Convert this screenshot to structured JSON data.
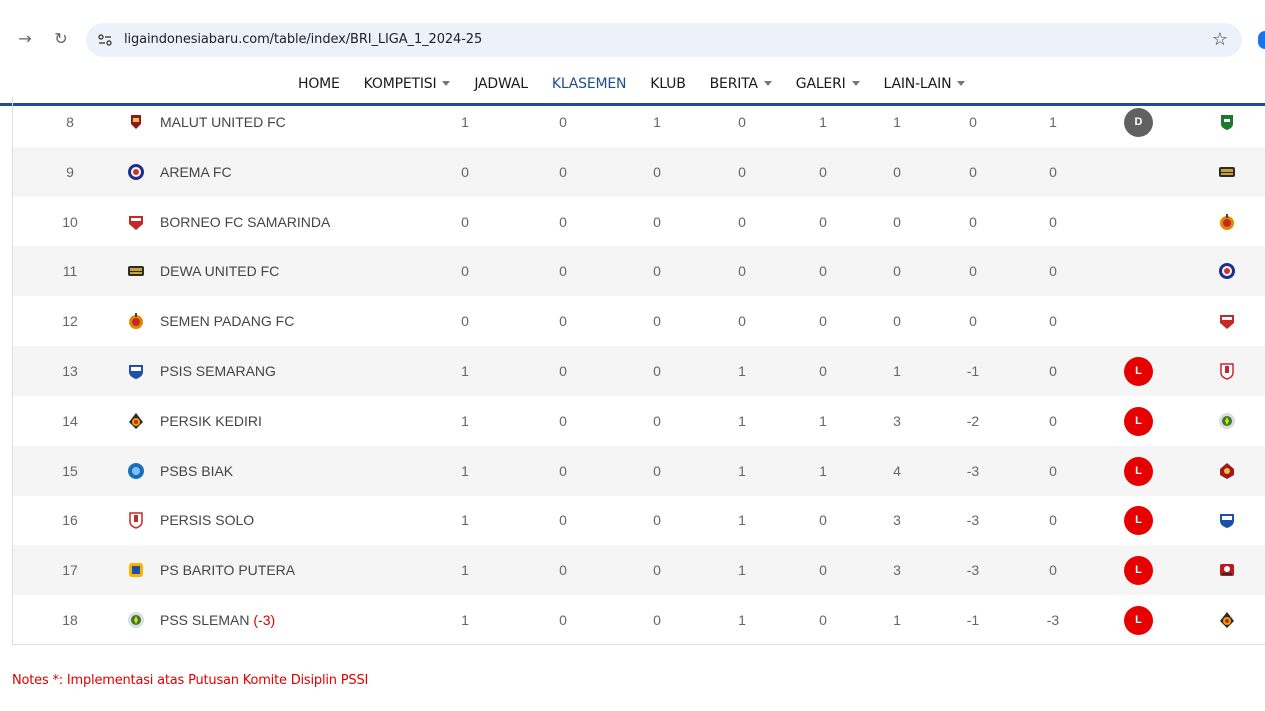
{
  "browser": {
    "back_icon": "arrow-right",
    "reload_icon": "reload",
    "url": "ligaindonesiabaru.com/table/index/BRI_LIGA_1_2024-25",
    "bookmark_icon": "star"
  },
  "menu": [
    {
      "label": "HOME",
      "dropdown": false,
      "active": false
    },
    {
      "label": "KOMPETISI",
      "dropdown": true,
      "active": false
    },
    {
      "label": "JADWAL",
      "dropdown": false,
      "active": false
    },
    {
      "label": "KLASEMEN",
      "dropdown": false,
      "active": true
    },
    {
      "label": "KLUB",
      "dropdown": false,
      "active": false
    },
    {
      "label": "BERITA",
      "dropdown": true,
      "active": false
    },
    {
      "label": "GALERI",
      "dropdown": true,
      "active": false
    },
    {
      "label": "LAIN-LAIN",
      "dropdown": true,
      "active": false
    }
  ],
  "standings": [
    {
      "pos": "8",
      "team": "MALUT UNITED FC",
      "deduction": "",
      "vals": [
        "1",
        "0",
        "1",
        "0",
        "1",
        "1",
        "0",
        "1"
      ],
      "last": "D",
      "crest": "malut",
      "next": "persebaya"
    },
    {
      "pos": "9",
      "team": "AREMA FC",
      "deduction": "",
      "vals": [
        "0",
        "0",
        "0",
        "0",
        "0",
        "0",
        "0",
        "0"
      ],
      "last": "",
      "crest": "arema",
      "next": "dewa"
    },
    {
      "pos": "10",
      "team": "BORNEO FC SAMARINDA",
      "deduction": "",
      "vals": [
        "0",
        "0",
        "0",
        "0",
        "0",
        "0",
        "0",
        "0"
      ],
      "last": "",
      "crest": "borneo",
      "next": "semen"
    },
    {
      "pos": "11",
      "team": "DEWA UNITED FC",
      "deduction": "",
      "vals": [
        "0",
        "0",
        "0",
        "0",
        "0",
        "0",
        "0",
        "0"
      ],
      "last": "",
      "crest": "dewa",
      "next": "arema"
    },
    {
      "pos": "12",
      "team": "SEMEN PADANG FC",
      "deduction": "",
      "vals": [
        "0",
        "0",
        "0",
        "0",
        "0",
        "0",
        "0",
        "0"
      ],
      "last": "",
      "crest": "semen",
      "next": "borneo"
    },
    {
      "pos": "13",
      "team": "PSIS SEMARANG",
      "deduction": "",
      "vals": [
        "1",
        "0",
        "0",
        "1",
        "0",
        "1",
        "-1",
        "0"
      ],
      "last": "L",
      "crest": "psis",
      "next": "persis"
    },
    {
      "pos": "14",
      "team": "PERSIK KEDIRI",
      "deduction": "",
      "vals": [
        "1",
        "0",
        "0",
        "1",
        "1",
        "3",
        "-2",
        "0"
      ],
      "last": "L",
      "crest": "persik",
      "next": "pss"
    },
    {
      "pos": "15",
      "team": "PSBS BIAK",
      "deduction": "",
      "vals": [
        "1",
        "0",
        "0",
        "1",
        "1",
        "4",
        "-3",
        "0"
      ],
      "last": "L",
      "crest": "psbs",
      "next": "psm"
    },
    {
      "pos": "16",
      "team": "PERSIS SOLO",
      "deduction": "",
      "vals": [
        "1",
        "0",
        "0",
        "1",
        "0",
        "3",
        "-3",
        "0"
      ],
      "last": "L",
      "crest": "persis",
      "next": "psis"
    },
    {
      "pos": "17",
      "team": "PS BARITO PUTERA",
      "deduction": "",
      "vals": [
        "1",
        "0",
        "0",
        "1",
        "0",
        "3",
        "-3",
        "0"
      ],
      "last": "L",
      "crest": "barito",
      "next": "madura"
    },
    {
      "pos": "18",
      "team": "PSS SLEMAN",
      "deduction": "(-3)",
      "vals": [
        "1",
        "0",
        "0",
        "1",
        "0",
        "1",
        "-1",
        "-3"
      ],
      "last": "L",
      "crest": "pss",
      "next": "persik"
    }
  ],
  "notes": "Notes *: Implementasi atas Putusan Komite Disiplin PSSI",
  "colors": {
    "nav_border": "#1f4e8a",
    "loss": "#e60000",
    "draw": "#616161",
    "deduction": "#e00000"
  }
}
